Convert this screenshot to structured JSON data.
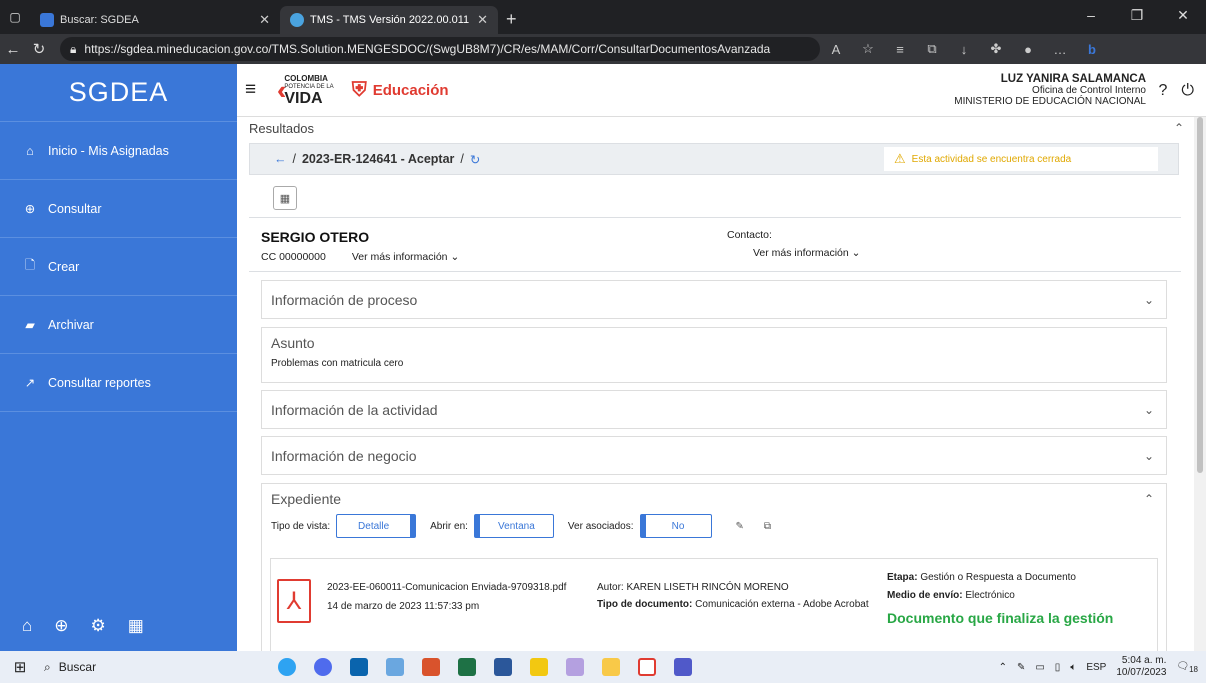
{
  "browser": {
    "tabs": [
      {
        "title": "Buscar: SGDEA",
        "active": false
      },
      {
        "title": "TMS - TMS Versión 2022.00.011",
        "active": true
      }
    ],
    "url": "https://sgdea.mineducacion.gov.co/TMS.Solution.MENGESDOC/(SwgUB8M7)/CR/es/MAM/Corr/ConsultarDocumentosAvanzada"
  },
  "sidebar": {
    "brand": "SGDEA",
    "items": [
      {
        "label": "Inicio - Mis Asignadas",
        "icon": "home-icon"
      },
      {
        "label": "Consultar",
        "icon": "search-icon"
      },
      {
        "label": "Crear",
        "icon": "file-icon"
      },
      {
        "label": "Archivar",
        "icon": "folder-icon"
      },
      {
        "label": "Consultar reportes",
        "icon": "chart-icon"
      }
    ]
  },
  "header": {
    "logo_colombia": "COLOMBIA",
    "logo_potencia": "POTENCIA DE LA",
    "logo_vida": "VIDA",
    "logo_edu": "Educación",
    "user_name": "LUZ YANIRA SALAMANCA",
    "user_office": "Oficina de Control Interno",
    "user_org": "MINISTERIO DE EDUCACIÓN NACIONAL"
  },
  "main": {
    "results_title": "Resultados",
    "breadcrumb": "2023-ER-124641 - Aceptar",
    "warning": "Esta actividad se encuentra cerrada",
    "person_name": "SERGIO OTERO",
    "person_cc": "CC 00000000",
    "ver_mas": "Ver más información",
    "contact_label": "Contacto:",
    "panels": {
      "proceso": "Información de proceso",
      "asunto": "Asunto",
      "asunto_text": "Problemas con matricula cero",
      "actividad": "Información de la actividad",
      "negocio": "Información de negocio",
      "expediente": "Expediente"
    },
    "exp_controls": {
      "tipo_label": "Tipo de vista:",
      "tipo_value": "Detalle",
      "abrir_label": "Abrir en:",
      "abrir_value": "Ventana",
      "asoc_label": "Ver asociados:",
      "asoc_value": "No"
    },
    "document": {
      "name": "2023-EE-060011-Comunicacion Enviada-9709318.pdf",
      "date": "14 de marzo de 2023 11:57:33 pm",
      "autor_label": "Autor:",
      "autor": "KAREN LISETH RINCÓN MORENO",
      "tipo_label": "Tipo de documento:",
      "tipo": "Comunicación externa - Adobe Acrobat",
      "etapa_label": "Etapa:",
      "etapa": "Gestión o Respuesta a Documento",
      "medio_label": "Medio de envío:",
      "medio": "Electrónico",
      "final": "Documento que finaliza la gestión"
    }
  },
  "taskbar": {
    "search": "Buscar",
    "lang": "ESP",
    "time": "5:04 a. m.",
    "date": "10/07/2023",
    "notif": "18"
  }
}
